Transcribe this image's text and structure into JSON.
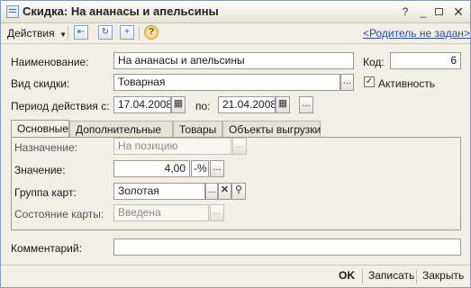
{
  "window": {
    "title": "Скидка: На ананасы и апельсины"
  },
  "toolbar": {
    "actions_label": "Действия",
    "parent_link": "<Родитель не задан>"
  },
  "form": {
    "name_label": "Наименование:",
    "name_value": "На ананасы и апельсины",
    "code_label": "Код:",
    "code_value": "6",
    "type_label": "Вид скидки:",
    "type_value": "Товарная",
    "active_label": "Активность",
    "active_checked": true,
    "period_label": "Период действия с:",
    "period_from": "17.04.2008",
    "period_to_label": "по:",
    "period_to": "21.04.2008"
  },
  "tabs": [
    {
      "label": "Основные",
      "active": true
    },
    {
      "label": "Дополнительные",
      "active": false
    },
    {
      "label": "Товары",
      "active": false
    },
    {
      "label": "Объекты выгрузки",
      "active": false
    }
  ],
  "main_tab": {
    "purpose_label": "Назначение:",
    "purpose_value": "На позицию",
    "value_label": "Значение:",
    "value_amount": "4,00",
    "value_unit": "-%",
    "card_group_label": "Группа карт:",
    "card_group_value": "Золотая",
    "card_state_label": "Состояние карты:",
    "card_state_value": "Введена"
  },
  "comment_label": "Комментарий:",
  "comment_value": "",
  "bottom": {
    "ok_label": "OK",
    "save_label": "Записать",
    "close_label": "Закрыть"
  },
  "colors": {
    "window_bg": "#f1efe6",
    "link": "#2a4ea8",
    "field_border": "#9a9a9a"
  }
}
